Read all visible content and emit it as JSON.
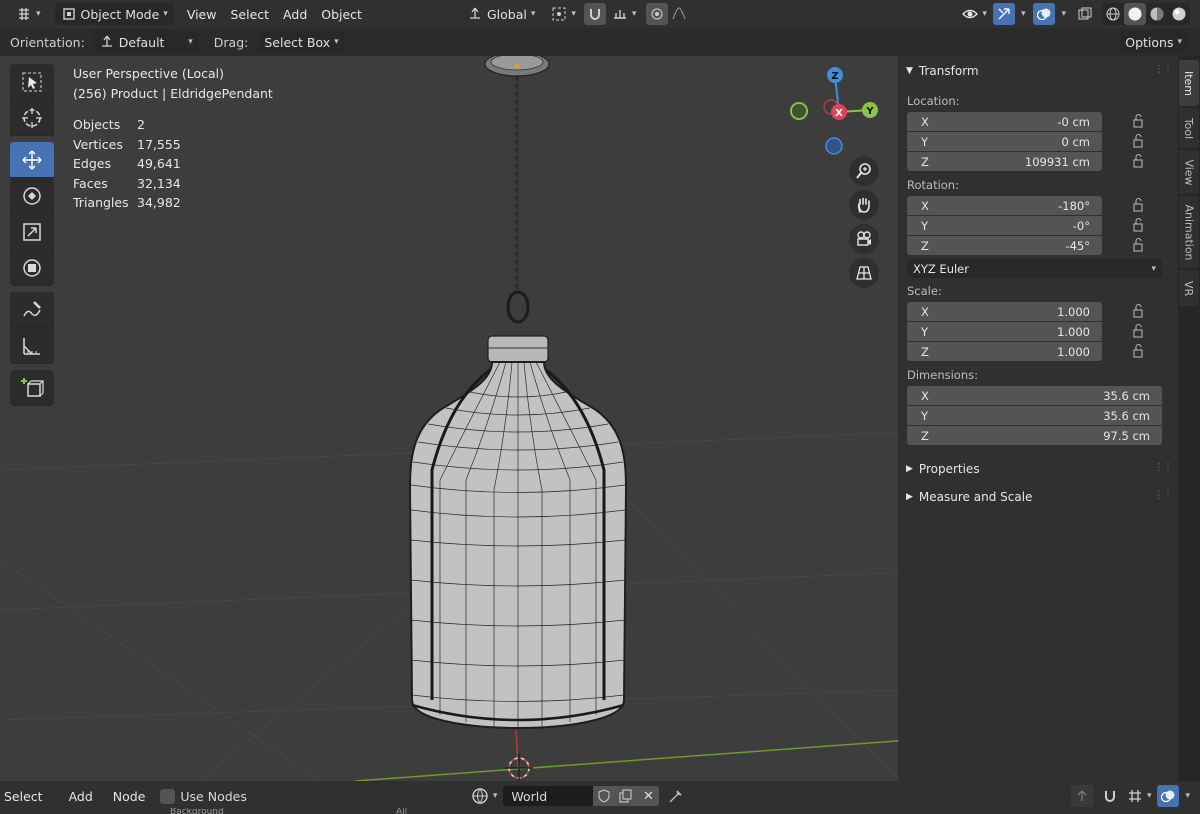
{
  "header": {
    "mode_label": "Object Mode",
    "menus": [
      "View",
      "Select",
      "Add",
      "Object"
    ],
    "transform_orientation": "Global"
  },
  "tool_settings": {
    "orientation_label": "Orientation:",
    "orientation_value": "Default",
    "drag_label": "Drag:",
    "drag_value": "Select Box",
    "options_label": "Options"
  },
  "overlay": {
    "view_name": "User Perspective (Local)",
    "collection_line": "(256) Product | EldridgePendant",
    "stats": [
      {
        "label": "Objects",
        "value": "2"
      },
      {
        "label": "Vertices",
        "value": "17,555"
      },
      {
        "label": "Edges",
        "value": "49,641"
      },
      {
        "label": "Faces",
        "value": "32,134"
      },
      {
        "label": "Triangles",
        "value": "34,982"
      }
    ]
  },
  "gizmo": {
    "x": "X",
    "y": "Y",
    "z": "Z"
  },
  "npanel": {
    "transform_title": "Transform",
    "location_label": "Location:",
    "location": [
      {
        "axis": "X",
        "value": "-0 cm"
      },
      {
        "axis": "Y",
        "value": "0 cm"
      },
      {
        "axis": "Z",
        "value": "109931 cm"
      }
    ],
    "rotation_label": "Rotation:",
    "rotation": [
      {
        "axis": "X",
        "value": "-180°"
      },
      {
        "axis": "Y",
        "value": "-0°"
      },
      {
        "axis": "Z",
        "value": "-45°"
      }
    ],
    "rotation_mode": "XYZ Euler",
    "scale_label": "Scale:",
    "scale": [
      {
        "axis": "X",
        "value": "1.000"
      },
      {
        "axis": "Y",
        "value": "1.000"
      },
      {
        "axis": "Z",
        "value": "1.000"
      }
    ],
    "dimensions_label": "Dimensions:",
    "dimensions": [
      {
        "axis": "X",
        "value": "35.6 cm"
      },
      {
        "axis": "Y",
        "value": "35.6 cm"
      },
      {
        "axis": "Z",
        "value": "97.5 cm"
      }
    ],
    "properties_title": "Properties",
    "measure_title": "Measure and Scale"
  },
  "side_tabs": [
    "Item",
    "Tool",
    "View",
    "Animation",
    "VR"
  ],
  "footer": {
    "menus": [
      "Select",
      "Add",
      "Node"
    ],
    "use_nodes_label": "Use Nodes",
    "world_name": "World",
    "cut_off_left": "Background",
    "cut_off_mid": "All"
  },
  "colors": {
    "accent_blue": "#4772b3",
    "axis_x": "#e04355",
    "axis_y": "#8bc34a",
    "axis_z": "#3d8fe0"
  }
}
